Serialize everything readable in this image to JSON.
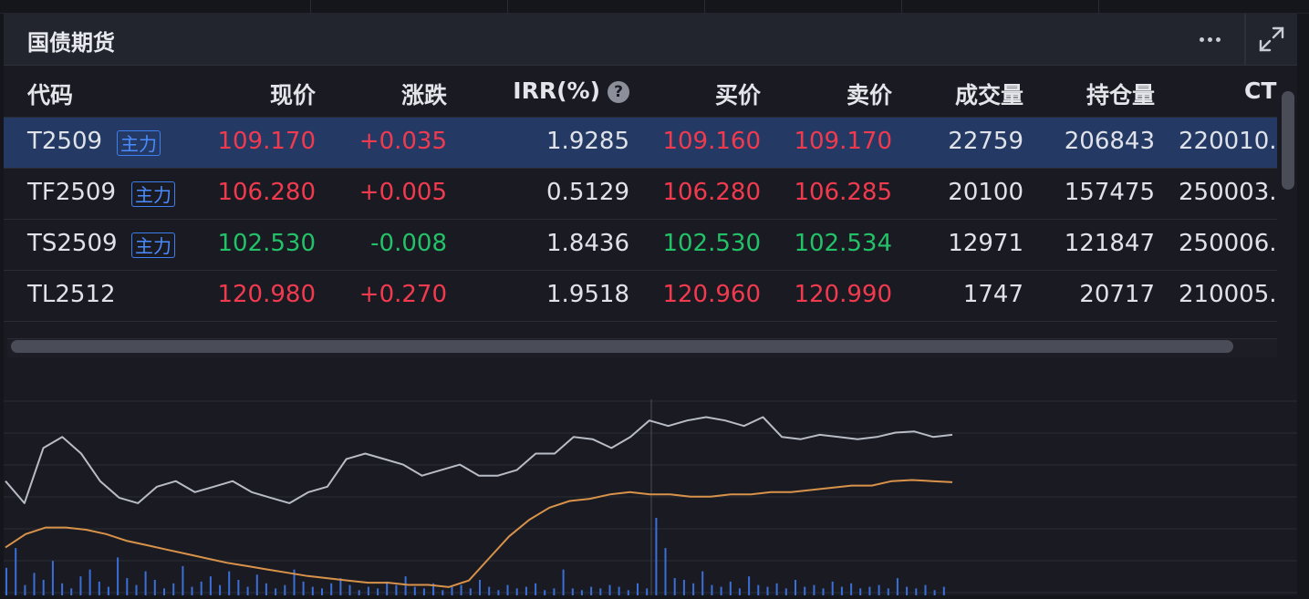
{
  "panel": {
    "title": "国债期货"
  },
  "icons": {
    "more": "more-horizontal-icon",
    "expand": "expand-icon",
    "help": "question-circle-icon"
  },
  "colors": {
    "up": "#f23a4f",
    "down": "#23c268",
    "selected_row": "#253965",
    "badge": "#3d7ef0",
    "price_line": "#b8bcc6",
    "avg_line": "#d9924a",
    "volume_bar": "#3b6fd8"
  },
  "table": {
    "headers": [
      "代码",
      "现价",
      "涨跌",
      "IRR(%)",
      "买价",
      "卖价",
      "成交量",
      "持仓量",
      "CT"
    ],
    "help_glyph": "?",
    "rows": [
      {
        "code": "T2509",
        "badge": "主力",
        "price": "109.170",
        "change": "+0.035",
        "irr": "1.9285",
        "bid": "109.160",
        "ask": "109.170",
        "volume": "22759",
        "oi": "206843",
        "ct": "220010.",
        "dir": "up",
        "selected": true
      },
      {
        "code": "TF2509",
        "badge": "主力",
        "price": "106.280",
        "change": "+0.005",
        "irr": "0.5129",
        "bid": "106.280",
        "ask": "106.285",
        "volume": "20100",
        "oi": "157475",
        "ct": "250003.",
        "dir": "up",
        "selected": false
      },
      {
        "code": "TS2509",
        "badge": "主力",
        "price": "102.530",
        "change": "-0.008",
        "irr": "1.8436",
        "bid": "102.530",
        "ask": "102.534",
        "volume": "12971",
        "oi": "121847",
        "ct": "250006.",
        "dir": "down",
        "selected": false
      },
      {
        "code": "TL2512",
        "badge": "",
        "price": "120.980",
        "change": "+0.270",
        "irr": "1.9518",
        "bid": "120.960",
        "ask": "120.990",
        "volume": "1747",
        "oi": "20717",
        "ct": "210005.",
        "dir": "up",
        "selected": false
      }
    ]
  },
  "chart_data": {
    "type": "line",
    "title": "",
    "series": [
      {
        "values": [
          109.12,
          109.1,
          109.15,
          109.16,
          109.145,
          109.12,
          109.105,
          109.1,
          109.115,
          109.12,
          109.11,
          109.115,
          109.12,
          109.11,
          109.105,
          109.1,
          109.11,
          109.115,
          109.14,
          109.145,
          109.14,
          109.135,
          109.125,
          109.13,
          109.135,
          109.125,
          109.125,
          109.13,
          109.145,
          109.145,
          109.16,
          109.158,
          109.15,
          109.16,
          109.175,
          109.17,
          109.175,
          109.178,
          109.175,
          109.17,
          109.178,
          109.16,
          109.158,
          109.162,
          109.16,
          109.158,
          109.16,
          109.164,
          109.165,
          109.16,
          109.162
        ]
      },
      {
        "values": [
          109.06,
          109.072,
          109.078,
          109.078,
          109.076,
          109.072,
          109.066,
          109.062,
          109.058,
          109.054,
          109.05,
          109.046,
          109.043,
          109.04,
          109.037,
          109.034,
          109.032,
          109.03,
          109.028,
          109.028,
          109.026,
          109.026,
          109.024,
          109.03,
          109.05,
          109.07,
          109.085,
          109.096,
          109.102,
          109.104,
          109.108,
          109.11,
          109.108,
          109.108,
          109.106,
          109.106,
          109.108,
          109.108,
          109.11,
          109.11,
          109.112,
          109.114,
          109.116,
          109.116,
          109.12,
          109.121,
          109.12,
          109.119
        ]
      }
    ],
    "volume": [
      32,
      55,
      12,
      26,
      18,
      40,
      14,
      8,
      22,
      30,
      16,
      10,
      44,
      20,
      12,
      28,
      18,
      8,
      14,
      34,
      10,
      16,
      22,
      12,
      28,
      18,
      10,
      24,
      14,
      8,
      12,
      30,
      16,
      10,
      8,
      14,
      20,
      12,
      6,
      10,
      8,
      16,
      12,
      22,
      10,
      8,
      14,
      6,
      10,
      12,
      8,
      18,
      10,
      6,
      12,
      8,
      10,
      14,
      6,
      8,
      30,
      8,
      6,
      10,
      8,
      12,
      10,
      6,
      14,
      8,
      90,
      55,
      20,
      18,
      14,
      28,
      12,
      10,
      16,
      8,
      22,
      12,
      10,
      14,
      8,
      18,
      10,
      12,
      8,
      16,
      10,
      14,
      8,
      10,
      12,
      8,
      20,
      10,
      8,
      12,
      6,
      10
    ],
    "grid": true
  }
}
